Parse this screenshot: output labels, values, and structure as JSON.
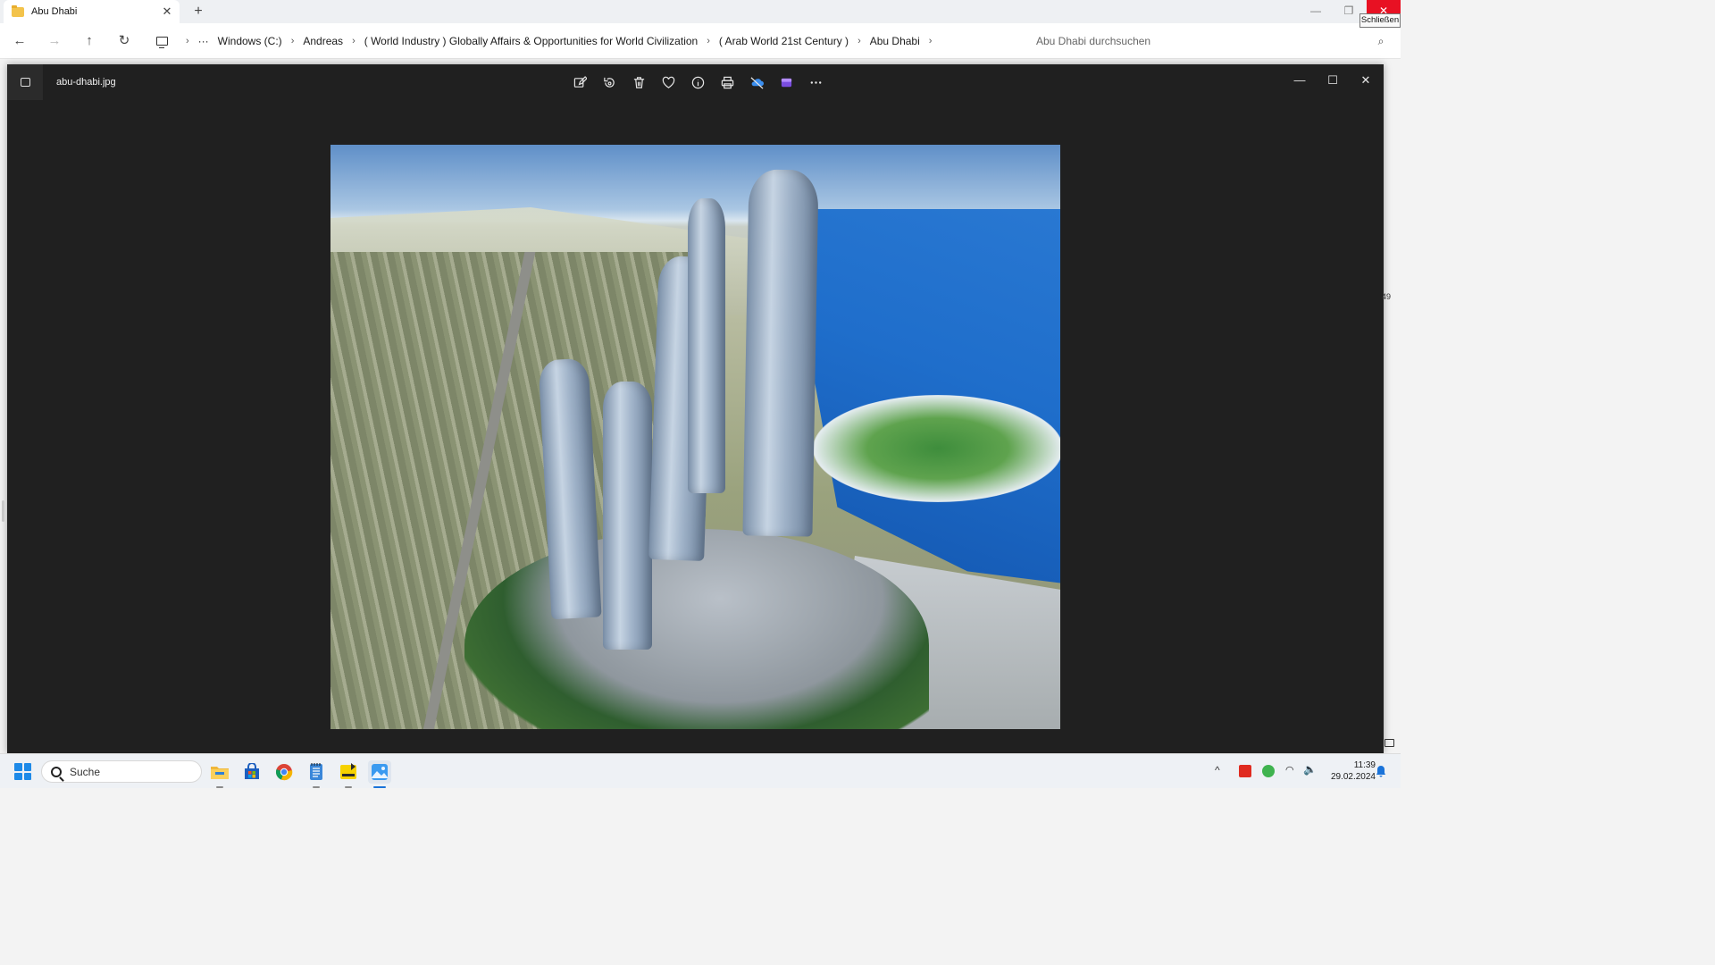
{
  "explorer": {
    "tab_title": "Abu Dhabi",
    "tab_close": "✕",
    "new_tab": "+",
    "window_controls": {
      "minimize": "—",
      "maximize": "❐",
      "close": "✕"
    },
    "close_tooltip": "Schließen",
    "nav": {
      "back": "←",
      "forward": "→",
      "up": "↑",
      "refresh": "↻"
    },
    "breadcrumb": {
      "overflow": "···",
      "items": [
        "Windows (C:)",
        "Andreas",
        "( World Industry ) Globally Affairs & Opportunities for World Civilization",
        "( Arab World 21st Century )",
        "Abu Dhabi"
      ],
      "separator": "›"
    },
    "search_placeholder": "Abu Dhabi durchsuchen"
  },
  "viewer": {
    "filename": "abu-dhabi.jpg",
    "toolbar": [
      "edit-icon",
      "rotate-icon",
      "delete-icon",
      "favorite-icon",
      "info-icon",
      "print-icon",
      "onedrive-icon",
      "clipchamp-icon",
      "more-icon"
    ],
    "controls": {
      "minimize": "—",
      "maximize": "☐",
      "close": "✕"
    }
  },
  "side_label": "49",
  "taskbar": {
    "search_label": "Suche",
    "apps": [
      "file-explorer-icon",
      "microsoft-store-icon",
      "chrome-icon",
      "notepad-icon",
      "media-player-icon",
      "photos-icon"
    ],
    "tray_chevron": "^",
    "clock_time": "11:39",
    "clock_date": "29.02.2024"
  },
  "colors": {
    "accent": "#1a73d9",
    "close_red": "#e81123",
    "viewer_bg": "#202020"
  }
}
